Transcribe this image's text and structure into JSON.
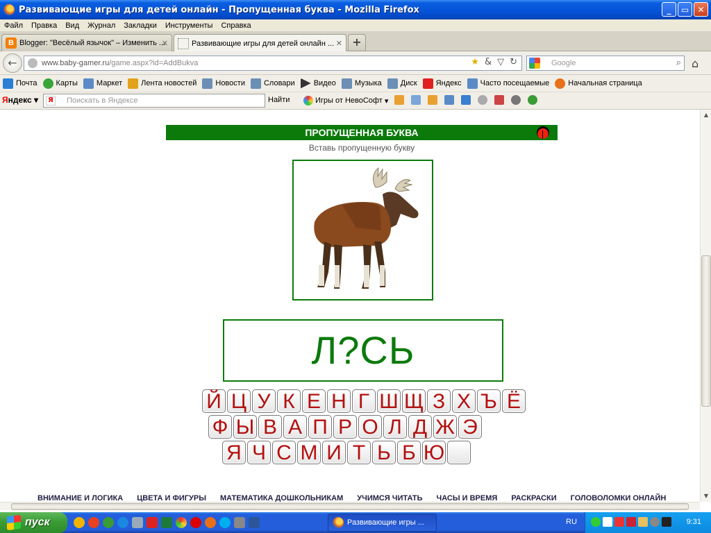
{
  "window": {
    "title": "Развивающие игры для детей онлайн - Пропущенная буква - Mozilla Firefox",
    "buttons": [
      "_",
      "▭",
      "✕"
    ]
  },
  "menu": [
    "Файл",
    "Правка",
    "Вид",
    "Журнал",
    "Закладки",
    "Инструменты",
    "Справка"
  ],
  "tabs": [
    {
      "label": "Blogger: \"Весёлый язычок\" – Изменить ...",
      "close": "✕"
    },
    {
      "label": "Развивающие игры для детей онлайн ...",
      "close": "✕"
    }
  ],
  "new_tab": "+",
  "nav": {
    "back": "←",
    "url_domain": "www.baby-gamer.ru",
    "url_path": "/game.aspx?id=AddBukva",
    "search_placeholder": "Google",
    "home": "⌂"
  },
  "bookmarks": [
    {
      "label": "Почта",
      "color": "#2a7fd4"
    },
    {
      "label": "Карты",
      "color": "#3aa53a"
    },
    {
      "label": "Маркет",
      "color": "#5b8ac7"
    },
    {
      "label": "Лента новостей",
      "color": "#e2a21b"
    },
    {
      "label": "Новости",
      "color": "#6b8fb5"
    },
    {
      "label": "Словари",
      "color": "#6b8fb5"
    },
    {
      "label": "Видео",
      "color": "#333333"
    },
    {
      "label": "Музыка",
      "color": "#6b8fb5"
    },
    {
      "label": "Диск",
      "color": "#6b8fb5"
    },
    {
      "label": "Яндекс",
      "color": "#e02020"
    },
    {
      "label": "Часто посещаемые",
      "color": "#5b8ac7"
    },
    {
      "label": "Начальная страница",
      "color": "#e8701a"
    }
  ],
  "yandex": {
    "logo_first": "Я",
    "logo_rest": "ндекс",
    "search_placeholder": "Поискать в Яндексе",
    "find": "Найти",
    "games": "Игры от НевоСофт"
  },
  "game": {
    "header": "ПРОПУЩЕННАЯ БУКВА",
    "instruction": "Вставь пропущенную букву",
    "word": "Л?СЬ",
    "keyboard": [
      [
        "Й",
        "Ц",
        "У",
        "К",
        "Е",
        "Н",
        "Г",
        "Ш",
        "Щ",
        "З",
        "Х",
        "Ъ",
        "Ё"
      ],
      [
        "Ф",
        "Ы",
        "В",
        "А",
        "П",
        "Р",
        "О",
        "Л",
        "Д",
        "Ж",
        "Э"
      ],
      [
        "Я",
        "Ч",
        "С",
        "М",
        "И",
        "Т",
        "Ь",
        "Б",
        "Ю",
        ""
      ]
    ],
    "footer_links": [
      "ВНИМАНИЕ И ЛОГИКА",
      "ЦВЕТА И ФИГУРЫ",
      "МАТЕМАТИКА ДОШКОЛЬНИКАМ",
      "УЧИМСЯ ЧИТАТЬ",
      "ЧАСЫ И ВРЕМЯ",
      "РАСКРАСКИ",
      "ГОЛОВОЛОМКИ ОНЛАЙН"
    ]
  },
  "taskbar": {
    "start": "пуск",
    "task": "Развивающие игры ...",
    "lang": "RU",
    "clock": "9:31"
  }
}
